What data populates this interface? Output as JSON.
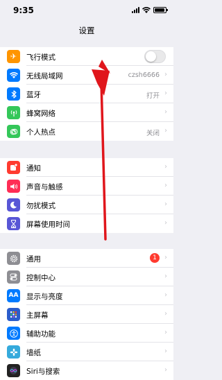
{
  "status_bar": {
    "time": "9:35"
  },
  "nav": {
    "title": "设置"
  },
  "groups": [
    {
      "rows": [
        {
          "label": "飞行模式",
          "icon": "airplane-icon",
          "color": "#ff9500",
          "type": "toggle",
          "on": false
        },
        {
          "label": "无线局域网",
          "icon": "wifi-icon",
          "color": "#007aff",
          "value": "czsh6666"
        },
        {
          "label": "蓝牙",
          "icon": "bluetooth-icon",
          "color": "#007aff",
          "value": "打开"
        },
        {
          "label": "蜂窝网络",
          "icon": "cellular-icon",
          "color": "#34c759",
          "value": ""
        },
        {
          "label": "个人热点",
          "icon": "hotspot-icon",
          "color": "#34c759",
          "value": "关闭"
        }
      ]
    },
    {
      "rows": [
        {
          "label": "通知",
          "icon": "notifications-icon",
          "color": "#ff3b30"
        },
        {
          "label": "声音与触感",
          "icon": "sound-icon",
          "color": "#ff2d55"
        },
        {
          "label": "勿扰模式",
          "icon": "moon-icon",
          "color": "#5856d6"
        },
        {
          "label": "屏幕使用时间",
          "icon": "hourglass-icon",
          "color": "#5856d6"
        }
      ]
    },
    {
      "rows": [
        {
          "label": "通用",
          "icon": "gear-icon",
          "color": "#8e8e93",
          "badge": "1"
        },
        {
          "label": "控制中心",
          "icon": "control-center-icon",
          "color": "#8e8e93"
        },
        {
          "label": "显示与亮度",
          "icon": "display-icon",
          "color": "#007aff"
        },
        {
          "label": "主屏幕",
          "icon": "home-screen-icon",
          "color": "#007aff"
        },
        {
          "label": "辅助功能",
          "icon": "accessibility-icon",
          "color": "#007aff"
        },
        {
          "label": "墙纸",
          "icon": "wallpaper-icon",
          "color": "#35aadc"
        },
        {
          "label": "Siri与搜索",
          "icon": "siri-icon",
          "color": "#222222"
        }
      ]
    }
  ],
  "annotation": {
    "arrow_color": "#e0161c"
  }
}
